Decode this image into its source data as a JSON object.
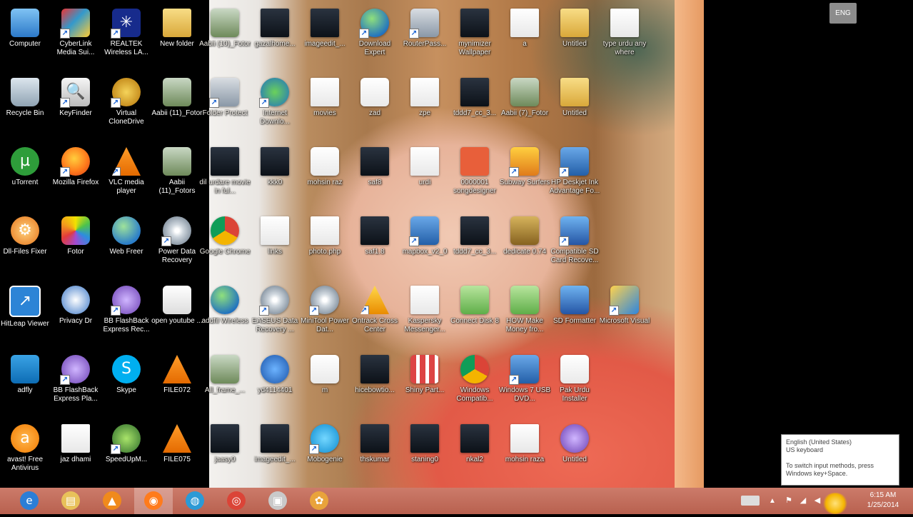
{
  "desktop": {
    "icons": [
      {
        "label": "Computer",
        "icon": "computer-icon",
        "style": "g-computer",
        "sym": "",
        "col": 0,
        "row": 0
      },
      {
        "label": "CyberLink Media Sui...",
        "icon": "cyberlink-icon",
        "style": "g-cyber",
        "sym": "",
        "col": 1,
        "row": 0,
        "shortcut": true
      },
      {
        "label": "REALTEK Wireless LA...",
        "icon": "realtek-icon",
        "style": "g-realtek",
        "sym": "✳",
        "col": 2,
        "row": 0,
        "shortcut": true
      },
      {
        "label": "New folder",
        "icon": "folder-icon",
        "style": "g-folder",
        "sym": "",
        "col": 3,
        "row": 0
      },
      {
        "label": "Recycle Bin",
        "icon": "recycle-bin-icon",
        "style": "g-bin",
        "sym": "",
        "col": 0,
        "row": 1
      },
      {
        "label": "KeyFinder",
        "icon": "keyfinder-icon",
        "style": "g-key",
        "sym": "🔍",
        "col": 1,
        "row": 1,
        "shortcut": true
      },
      {
        "label": "Virtual CloneDrive",
        "icon": "clonedrive-icon",
        "style": "g-clone",
        "sym": "",
        "col": 2,
        "row": 1,
        "shortcut": true
      },
      {
        "label": "Aabii (11)_Fotor",
        "icon": "photo-icon",
        "style": "g-photo",
        "sym": "",
        "col": 3,
        "row": 1
      },
      {
        "label": "uTorrent",
        "icon": "utorrent-icon",
        "style": "g-utorrent",
        "sym": "µ",
        "col": 0,
        "row": 2
      },
      {
        "label": "Mozilla Firefox",
        "icon": "firefox-icon",
        "style": "g-firefox",
        "sym": "",
        "col": 1,
        "row": 2,
        "shortcut": true
      },
      {
        "label": "VLC media player",
        "icon": "vlc-icon",
        "style": "g-vlc",
        "sym": "",
        "col": 2,
        "row": 2,
        "shortcut": true
      },
      {
        "label": "Aabii (11)_Fotors",
        "icon": "photo-icon",
        "style": "g-photo",
        "sym": "",
        "col": 3,
        "row": 2
      },
      {
        "label": "Dll-Files Fixer",
        "icon": "dll-fixer-icon",
        "style": "g-dll",
        "sym": "⚙",
        "col": 0,
        "row": 3
      },
      {
        "label": "Fotor",
        "icon": "fotor-icon",
        "style": "g-fotor",
        "sym": "",
        "col": 1,
        "row": 3
      },
      {
        "label": "Web Freer",
        "icon": "webfreer-icon",
        "style": "g-webfreer",
        "sym": "",
        "col": 2,
        "row": 3
      },
      {
        "label": "Power Data Recovery",
        "icon": "data-recovery-icon",
        "style": "g-disk",
        "sym": "",
        "col": 3,
        "row": 3,
        "shortcut": true
      },
      {
        "label": "HitLeap Viewer",
        "icon": "hitleap-icon",
        "style": "g-hitleap",
        "sym": "↗",
        "col": 0,
        "row": 4
      },
      {
        "label": "Privacy Dr",
        "icon": "privacy-dr-icon",
        "style": "g-privacy",
        "sym": "",
        "col": 1,
        "row": 4
      },
      {
        "label": "BB FlashBack Express Rec...",
        "icon": "flashback-recorder-icon",
        "style": "g-flashback",
        "sym": "",
        "col": 2,
        "row": 4,
        "shortcut": true
      },
      {
        "label": "open youtube ...",
        "icon": "youtube-shortcut-icon",
        "style": "g-youtube",
        "sym": "",
        "col": 3,
        "row": 4
      },
      {
        "label": "adfly",
        "icon": "adfly-icon",
        "style": "g-adfly",
        "sym": "",
        "col": 0,
        "row": 5
      },
      {
        "label": "BB FlashBack Express Pla...",
        "icon": "flashback-player-icon",
        "style": "g-flashback",
        "sym": "",
        "col": 1,
        "row": 5,
        "shortcut": true
      },
      {
        "label": "Skype",
        "icon": "skype-icon",
        "style": "g-skype",
        "sym": "S",
        "col": 2,
        "row": 5
      },
      {
        "label": "FILE072",
        "icon": "vlc-file-icon",
        "style": "g-vlc",
        "sym": "",
        "col": 3,
        "row": 5
      },
      {
        "label": "avast! Free Antivirus",
        "icon": "avast-icon",
        "style": "g-avast",
        "sym": "a",
        "col": 0,
        "row": 6
      },
      {
        "label": "jaz dhami",
        "icon": "document-icon",
        "style": "g-doc",
        "sym": "",
        "col": 1,
        "row": 6
      },
      {
        "label": "SpeedUpM...",
        "icon": "speedup-icon",
        "style": "g-speedup",
        "sym": "",
        "col": 2,
        "row": 6,
        "shortcut": true
      },
      {
        "label": "FILE075",
        "icon": "vlc-file-icon",
        "style": "g-vlc",
        "sym": "",
        "col": 3,
        "row": 6
      }
    ],
    "wallpaper_icons": [
      {
        "label": "Aabii (10)_Fotor",
        "icon": "photo-icon",
        "style": "g-photo",
        "col": 0,
        "row": 0
      },
      {
        "label": "gazalhome...",
        "icon": "video-icon",
        "style": "g-video",
        "col": 1,
        "row": 0
      },
      {
        "label": "imageedit_...",
        "icon": "video-icon",
        "style": "g-video",
        "col": 2,
        "row": 0
      },
      {
        "label": "Download Expert",
        "icon": "globe-icon",
        "style": "g-globe",
        "col": 3,
        "row": 0,
        "shortcut": true
      },
      {
        "label": "RouterPass...",
        "icon": "router-icon",
        "style": "g-router",
        "col": 4,
        "row": 0,
        "shortcut": true
      },
      {
        "label": "mynimizer Wallpaper",
        "icon": "video-icon",
        "style": "g-video",
        "col": 5,
        "row": 0
      },
      {
        "label": "a",
        "icon": "document-icon",
        "style": "g-doc",
        "col": 6,
        "row": 0
      },
      {
        "label": "Untitled",
        "icon": "folder-icon",
        "style": "g-folder",
        "col": 7,
        "row": 0
      },
      {
        "label": "type urdu any where",
        "icon": "document-icon",
        "style": "g-doc",
        "col": 8,
        "row": 0
      },
      {
        "label": "Folder Protect",
        "icon": "folder-protect-icon",
        "style": "g-router",
        "col": 0,
        "row": 1,
        "shortcut": true
      },
      {
        "label": "Internet Downlo...",
        "icon": "idm-icon",
        "style": "g-idm",
        "col": 1,
        "row": 1,
        "shortcut": true
      },
      {
        "label": "movies",
        "icon": "document-icon",
        "style": "g-doc",
        "col": 2,
        "row": 1
      },
      {
        "label": "zad",
        "icon": "firefox-document-icon",
        "style": "g-firefoxdoc",
        "col": 3,
        "row": 1
      },
      {
        "label": "zpe",
        "icon": "document-icon",
        "style": "g-doc",
        "col": 4,
        "row": 1
      },
      {
        "label": "tddd7_cc_3...",
        "icon": "video-icon",
        "style": "g-video",
        "col": 5,
        "row": 1
      },
      {
        "label": "Aabii (7)_Fotor",
        "icon": "photo-icon",
        "style": "g-photo",
        "col": 6,
        "row": 1
      },
      {
        "label": "Untitled",
        "icon": "folder-icon",
        "style": "g-folder",
        "col": 7,
        "row": 1
      },
      {
        "label": "dil urdare movie in ful...",
        "icon": "video-icon",
        "style": "g-video",
        "col": 0,
        "row": 2
      },
      {
        "label": "kkk0",
        "icon": "video-icon",
        "style": "g-video",
        "col": 1,
        "row": 2
      },
      {
        "label": "mohsin raz",
        "icon": "firefox-document-icon",
        "style": "g-firefoxdoc",
        "col": 2,
        "row": 2
      },
      {
        "label": "saf8",
        "icon": "video-icon",
        "style": "g-video",
        "col": 3,
        "row": 2
      },
      {
        "label": "urdi",
        "icon": "document-icon",
        "style": "g-doc",
        "col": 4,
        "row": 2
      },
      {
        "label": "0000001 songdesigner",
        "icon": "music-icon",
        "style": "g-music",
        "col": 5,
        "row": 2
      },
      {
        "label": "Subway Surfers",
        "icon": "subway-icon",
        "style": "g-subway",
        "col": 6,
        "row": 2,
        "shortcut": true
      },
      {
        "label": "HP Deskjet Ink Advantage Fo...",
        "icon": "setup-icon",
        "style": "g-setup",
        "col": 7,
        "row": 2,
        "shortcut": true
      },
      {
        "label": "Google Chrome",
        "icon": "chrome-icon",
        "style": "g-chrome",
        "col": 0,
        "row": 3
      },
      {
        "label": "links",
        "icon": "document-icon",
        "style": "g-doc",
        "col": 1,
        "row": 3
      },
      {
        "label": "photo.php",
        "icon": "document-icon",
        "style": "g-doc",
        "col": 2,
        "row": 3
      },
      {
        "label": "saf1.8",
        "icon": "video-icon",
        "style": "g-video",
        "col": 3,
        "row": 3
      },
      {
        "label": "mapbox_v2_0",
        "icon": "setup-icon",
        "style": "g-setup",
        "col": 4,
        "row": 3,
        "shortcut": true
      },
      {
        "label": "tddd7_cc_3...",
        "icon": "video-icon",
        "style": "g-video",
        "col": 5,
        "row": 3
      },
      {
        "label": "dedicate 0.74",
        "icon": "bronze-icon",
        "style": "g-bronze",
        "col": 6,
        "row": 3
      },
      {
        "label": "Compatible SD Card Recove...",
        "icon": "sd-card-icon",
        "style": "g-sd",
        "col": 7,
        "row": 3,
        "shortcut": true
      },
      {
        "label": "addfil Wireless",
        "icon": "globe-icon",
        "style": "g-globe",
        "col": 0,
        "row": 4
      },
      {
        "label": "EASEUS Data Recovery ...",
        "icon": "data-recovery-icon",
        "style": "g-disk",
        "col": 1,
        "row": 4,
        "shortcut": true
      },
      {
        "label": "MiniTool Power Dat...",
        "icon": "disk-icon",
        "style": "g-disk",
        "col": 2,
        "row": 4,
        "shortcut": true
      },
      {
        "label": "Ontrack Cross Center",
        "icon": "warning-icon",
        "style": "g-warning",
        "col": 3,
        "row": 4,
        "shortcut": true
      },
      {
        "label": "Kaspersky Messenger...",
        "icon": "document-icon",
        "style": "g-doc",
        "col": 4,
        "row": 4
      },
      {
        "label": "Connect Disk 8",
        "icon": "green-icon",
        "style": "g-green",
        "col": 5,
        "row": 4
      },
      {
        "label": "HOW Make Money fro...",
        "icon": "green-icon",
        "style": "g-green",
        "col": 6,
        "row": 4
      },
      {
        "label": "SD Formatter",
        "icon": "sd-card-icon",
        "style": "g-sd",
        "col": 7,
        "row": 4
      },
      {
        "label": "Microsoft Visual",
        "icon": "visual-studio-icon",
        "style": "g-visual",
        "col": 8,
        "row": 4,
        "shortcut": true
      },
      {
        "label": "All_frame_...",
        "icon": "photo-icon",
        "style": "g-photo",
        "col": 0,
        "row": 5
      },
      {
        "label": "yd4114401",
        "icon": "help-icon",
        "style": "g-question",
        "col": 1,
        "row": 5
      },
      {
        "label": "m",
        "icon": "firefox-document-icon",
        "style": "g-firefoxdoc",
        "col": 2,
        "row": 5
      },
      {
        "label": "hicebowtio...",
        "icon": "video-icon",
        "style": "g-video",
        "col": 3,
        "row": 5
      },
      {
        "label": "Shiny Part...",
        "icon": "grid-icon",
        "style": "g-shiny",
        "col": 4,
        "row": 5
      },
      {
        "label": "Windows Compatib...",
        "icon": "chrome-icon",
        "style": "g-chrome",
        "col": 5,
        "row": 5
      },
      {
        "label": "Windows 7 USB DVD...",
        "icon": "setup-icon",
        "style": "g-setup",
        "col": 6,
        "row": 5,
        "shortcut": true
      },
      {
        "label": "Pak Urdu Installer",
        "icon": "firefox-document-icon",
        "style": "g-firefoxdoc",
        "col": 7,
        "row": 5
      },
      {
        "label": "jaasy0",
        "icon": "video-icon",
        "style": "g-video",
        "col": 0,
        "row": 6
      },
      {
        "label": "imageedit_...",
        "icon": "video-icon",
        "style": "g-video",
        "col": 1,
        "row": 6
      },
      {
        "label": "Mobogenie",
        "icon": "mobogenie-icon",
        "style": "g-mobogenie",
        "col": 2,
        "row": 6,
        "shortcut": true
      },
      {
        "label": "thskumar",
        "icon": "video-icon",
        "style": "g-video",
        "col": 3,
        "row": 6
      },
      {
        "label": "staning0",
        "icon": "video-icon",
        "style": "g-video",
        "col": 4,
        "row": 6
      },
      {
        "label": "nkal2",
        "icon": "video-icon",
        "style": "g-video",
        "col": 5,
        "row": 6
      },
      {
        "label": "mohsin raza",
        "icon": "document-icon",
        "style": "g-doc",
        "col": 6,
        "row": 6
      },
      {
        "label": "Untitled",
        "icon": "flashback-icon",
        "style": "g-flashback",
        "col": 7,
        "row": 6
      }
    ]
  },
  "lang_tooltip": {
    "language": "English (United States)",
    "keyboard": "US keyboard",
    "hint": "To switch input methods, press Windows key+Space."
  },
  "taskbar": {
    "apps": [
      {
        "name": "internet-explorer-icon",
        "sym": "e",
        "color": "#2b7ed6"
      },
      {
        "name": "file-explorer-icon",
        "sym": "▤",
        "color": "#e8c15a"
      },
      {
        "name": "vlc-icon",
        "sym": "▲",
        "color": "#f08a1c"
      },
      {
        "name": "firefox-icon",
        "sym": "◉",
        "color": "#ff7b1c",
        "active": true
      },
      {
        "name": "globe-icon",
        "sym": "◍",
        "color": "#2b9ad6"
      },
      {
        "name": "chrome-icon",
        "sym": "◎",
        "color": "#db4437"
      },
      {
        "name": "print-icon",
        "sym": "▣",
        "color": "#c9c9c9"
      },
      {
        "name": "fotor-icon",
        "sym": "✿",
        "color": "#e9a33b"
      }
    ],
    "tray": {
      "lang_label": "ENG",
      "time": "6:15 AM",
      "date": "1/25/2014"
    }
  }
}
